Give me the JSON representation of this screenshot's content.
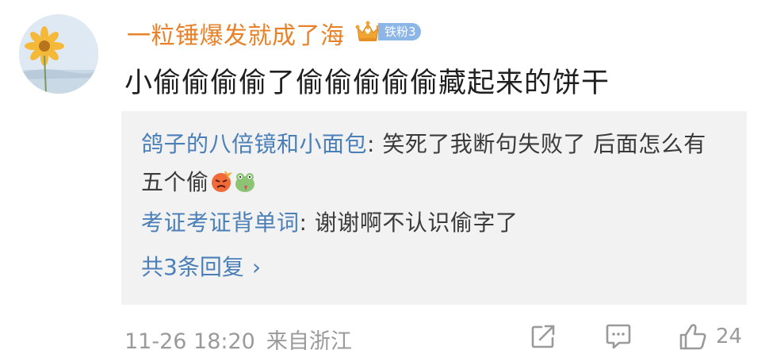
{
  "comment": {
    "username": "一粒锤爆发就成了海",
    "fan_badge": "铁粉3",
    "text": "小偷偷偷偷了偷偷偷偷偷藏起来的饼干",
    "timestamp": "11-26 18:20",
    "location": "来自浙江",
    "like_count": "24"
  },
  "replies": [
    {
      "name": "鸽子的八倍镜和小面包",
      "text": "笑死了我断句失败了  后面怎么有五个偷",
      "emojis": [
        "angry-face-emoji",
        "frog-emoji"
      ]
    },
    {
      "name": "考证考证背单词",
      "text": "谢谢啊不认识偷字了"
    }
  ],
  "more_replies_label": "共3条回复",
  "icons": {
    "share": "share-icon",
    "comment": "comment-icon",
    "like": "thumbs-up-icon",
    "crown": "crown-icon"
  },
  "colors": {
    "username": "#e8822a",
    "reply_name": "#4a7fb8",
    "badge": "#8cb5e8",
    "meta": "#9a9a9a",
    "reply_bg": "#f2f2f2"
  }
}
